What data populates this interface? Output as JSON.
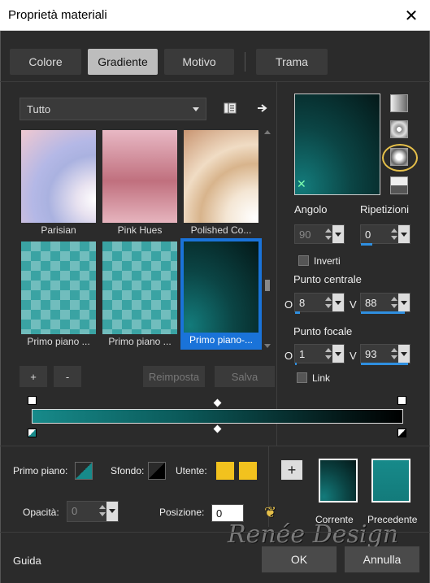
{
  "window": {
    "title": "Proprietà materiali",
    "close_glyph": "✕"
  },
  "tabs": [
    {
      "label": "Colore",
      "active": false
    },
    {
      "label": "Gradiente",
      "active": true
    },
    {
      "label": "Motivo",
      "active": false
    },
    {
      "label": "Trama",
      "active": false
    }
  ],
  "category": {
    "selected": "Tutto"
  },
  "gradients": [
    {
      "label": "Parisian",
      "selected": false
    },
    {
      "label": "Pink Hues",
      "selected": false
    },
    {
      "label": "Polished Co...",
      "selected": false
    },
    {
      "label": "Primo piano ...",
      "selected": false
    },
    {
      "label": "Primo piano ...",
      "selected": false
    },
    {
      "label": "Primo piano-...",
      "selected": true
    }
  ],
  "list_buttons": {
    "add": "+",
    "remove": "-",
    "reset": "Reimposta",
    "save": "Salva"
  },
  "angle": {
    "label": "Angolo",
    "value": "90"
  },
  "repeats": {
    "label": "Ripetizioni",
    "value": "0"
  },
  "invert": {
    "label": "Inverti",
    "checked": false
  },
  "center_point": {
    "label": "Punto centrale",
    "h_label": "O",
    "h_value": "8",
    "v_label": "V",
    "v_value": "88"
  },
  "focal_point": {
    "label": "Punto focale",
    "h_label": "O",
    "h_value": "1",
    "v_label": "V",
    "v_value": "93"
  },
  "link": {
    "label": "Link",
    "checked": false
  },
  "gradient_styles": [
    "linear-icon",
    "rectangular-icon",
    "radial-icon",
    "sunburst-icon"
  ],
  "foreground": {
    "label": "Primo piano:",
    "color": "#178a8a"
  },
  "background": {
    "label": "Sfondo:",
    "color": "#000000"
  },
  "user": {
    "label": "Utente:",
    "color1": "#f2c21e",
    "color2": "#f2c21e"
  },
  "opacity": {
    "label": "Opacità:",
    "value": "0"
  },
  "position": {
    "label": "Posizione:",
    "value": "0"
  },
  "current": {
    "label": "Corrente"
  },
  "previous": {
    "label": "Precedente"
  },
  "footer": {
    "help": "Guida",
    "ok": "OK",
    "cancel": "Annulla"
  },
  "watermark": {
    "text": "Renée Design"
  }
}
